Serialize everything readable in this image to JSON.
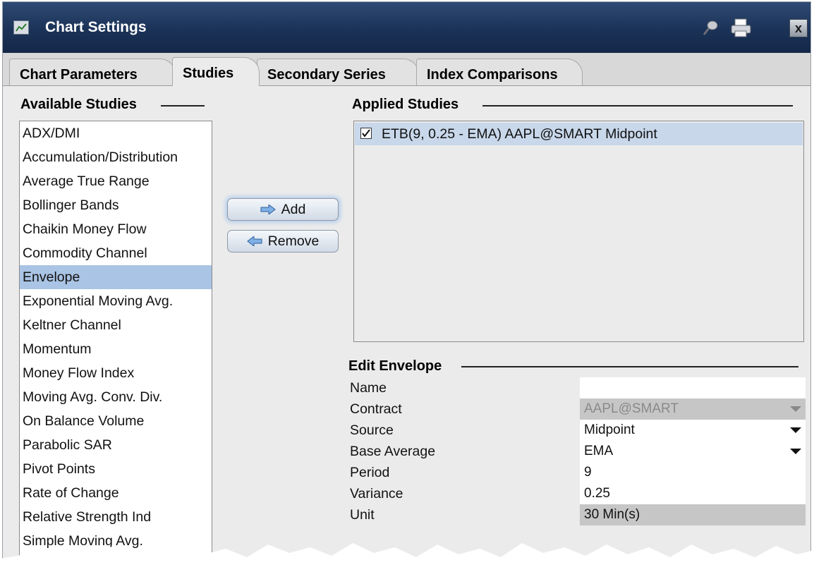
{
  "window": {
    "title": "Chart Settings",
    "close_glyph": "x"
  },
  "tabs": [
    {
      "label": "Chart Parameters",
      "active": false
    },
    {
      "label": "Studies",
      "active": true
    },
    {
      "label": "Secondary Series",
      "active": false
    },
    {
      "label": "Index Comparisons",
      "active": false
    }
  ],
  "available": {
    "header": "Available Studies",
    "items": [
      "ADX/DMI",
      "Accumulation/Distribution",
      "Average True Range",
      "Bollinger Bands",
      "Chaikin Money Flow",
      "Commodity Channel",
      "Envelope",
      "Exponential Moving Avg.",
      "Keltner Channel",
      "Momentum",
      "Money Flow Index",
      "Moving Avg. Conv. Div.",
      "On Balance Volume",
      "Parabolic SAR",
      "Pivot Points",
      "Rate of Change",
      "Relative Strength Ind",
      "Simple Moving Avg."
    ],
    "selected_item": "Envelope"
  },
  "buttons": {
    "add": "Add",
    "remove": "Remove"
  },
  "applied": {
    "header": "Applied Studies",
    "items": [
      {
        "checked": true,
        "text": "ETB(9, 0.25 - EMA) AAPL@SMART Midpoint"
      }
    ]
  },
  "edit": {
    "header": "Edit Envelope",
    "fields": {
      "name": {
        "label": "Name",
        "value": ""
      },
      "contract": {
        "label": "Contract",
        "value": "AAPL@SMART"
      },
      "source": {
        "label": "Source",
        "value": "Midpoint"
      },
      "base_average": {
        "label": "Base Average",
        "value": "EMA"
      },
      "period": {
        "label": "Period",
        "value": "9"
      },
      "variance": {
        "label": "Variance",
        "value": "0.25"
      },
      "unit": {
        "label": "Unit",
        "value": "30 Min(s)"
      }
    }
  },
  "icons": {
    "window": "chart-icon",
    "pin": "pin-icon",
    "print": "printer-icon",
    "add": "arrow-right-icon",
    "remove": "arrow-left-icon"
  },
  "colors": {
    "titlebar": "#1b3257",
    "selection": "#a9c4e4",
    "applied_highlight": "#c8d7ea",
    "window_bg": "#ebebeb"
  }
}
